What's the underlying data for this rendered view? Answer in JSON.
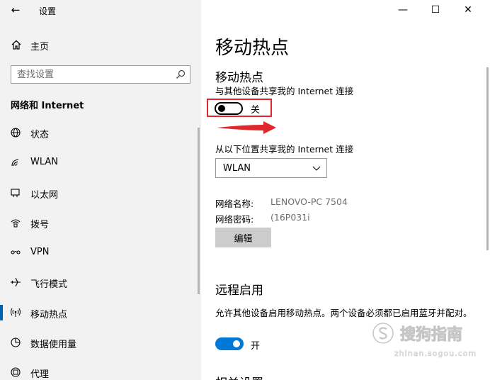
{
  "window": {
    "title": "设置",
    "controls": {
      "minimize": "—",
      "maximize": "☐",
      "close": "✕"
    }
  },
  "sidebar": {
    "back_icon": "←",
    "home_label": "主页",
    "search_placeholder": "查找设置",
    "section_heading": "网络和 Internet",
    "items": [
      {
        "label": "状态",
        "icon": "globe-icon",
        "active": false
      },
      {
        "label": "WLAN",
        "icon": "wifi-icon",
        "active": false
      },
      {
        "label": "以太网",
        "icon": "ethernet-icon",
        "active": false
      },
      {
        "label": "拨号",
        "icon": "dialup-icon",
        "active": false
      },
      {
        "label": "VPN",
        "icon": "vpn-icon",
        "active": false
      },
      {
        "label": "飞行模式",
        "icon": "airplane-icon",
        "active": false
      },
      {
        "label": "移动热点",
        "icon": "hotspot-icon",
        "active": true
      },
      {
        "label": "数据使用量",
        "icon": "data-usage-icon",
        "active": false
      },
      {
        "label": "代理",
        "icon": "proxy-icon",
        "active": false
      }
    ]
  },
  "main": {
    "page_title": "移动热点",
    "hotspot": {
      "heading": "移动热点",
      "share_desc": "与其他设备共享我的 Internet 连接",
      "toggle_state": "关",
      "share_from_label": "从以下位置共享我的 Internet 连接",
      "share_from_value": "WLAN",
      "network_name_label": "网络名称:",
      "network_name_value": "LENOVO-PC 7504",
      "network_password_label": "网络密码:",
      "network_password_value": "(16P031i",
      "edit_button": "编辑"
    },
    "remote": {
      "heading": "远程启用",
      "desc": "允许其他设备启用移动热点。两个设备必须都已启用蓝牙并配对。",
      "toggle_state": "开"
    },
    "related_heading": "相关设置"
  },
  "watermark": {
    "text": "搜狗指南",
    "url": "zhinan.sogou.com"
  },
  "colors": {
    "accent": "#0078d7",
    "highlight_box": "#e0272b",
    "sidebar_bg": "#f2f2f2"
  }
}
